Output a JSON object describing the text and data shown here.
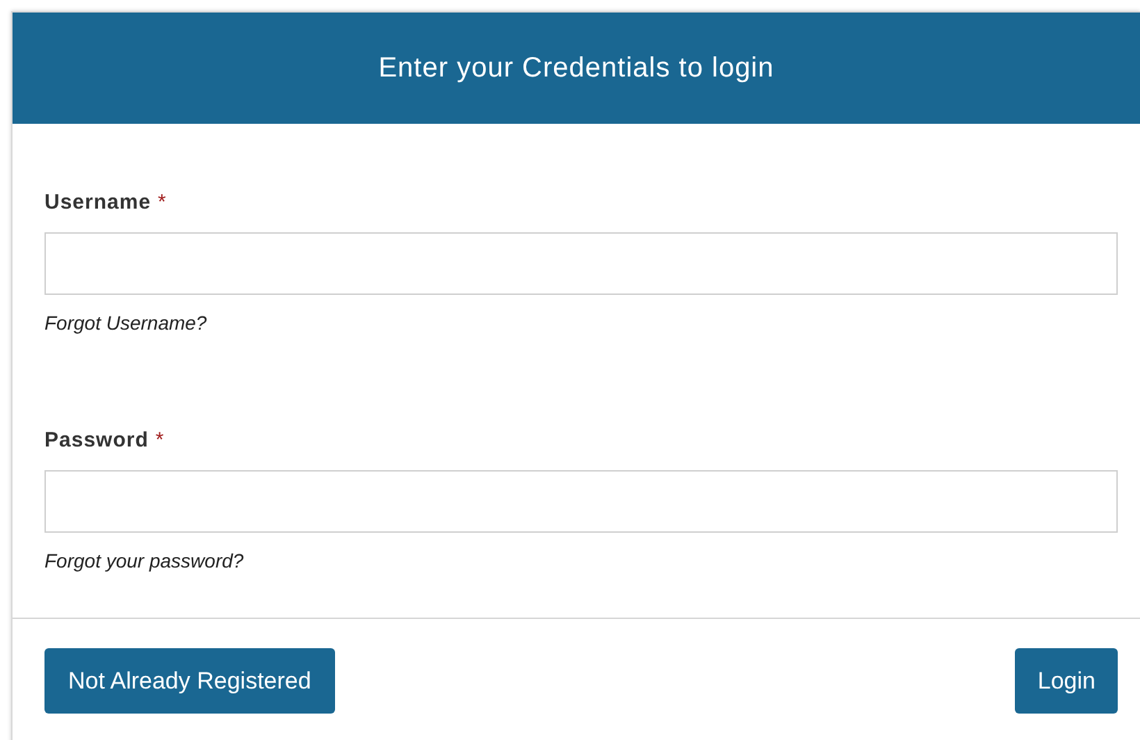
{
  "header": {
    "title": "Enter your Credentials to login"
  },
  "fields": [
    {
      "label": "Username",
      "required_mark": "*",
      "help_link": "Forgot Username?"
    },
    {
      "label": "Password",
      "required_mark": "*",
      "help_link": "Forgot your password?"
    }
  ],
  "buttons": {
    "secondary": "Not Already Registered",
    "primary": "Login"
  }
}
